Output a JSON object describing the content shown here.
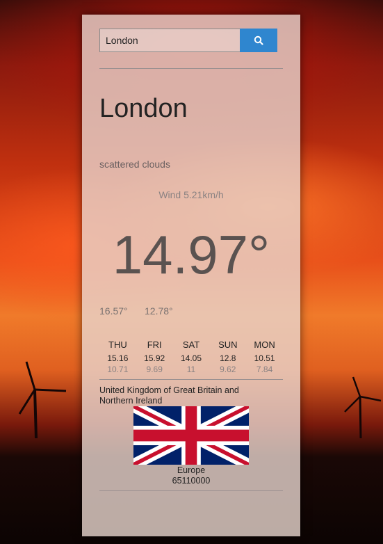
{
  "search": {
    "value": "London",
    "placeholder": ""
  },
  "weather": {
    "city": "London",
    "description": "scattered clouds",
    "wind": "Wind 5.21km/h",
    "temperature": "14.97°",
    "min": "16.57°",
    "max": "12.78°"
  },
  "forecast": [
    {
      "day": "THU",
      "high": "15.16",
      "low": "10.71"
    },
    {
      "day": "FRI",
      "high": "15.92",
      "low": "9.69"
    },
    {
      "day": "SAT",
      "high": "14.05",
      "low": "11"
    },
    {
      "day": "SUN",
      "high": "12.8",
      "low": "9.62"
    },
    {
      "day": "MON",
      "high": "10.51",
      "low": "7.84"
    }
  ],
  "country": {
    "name": "United Kingdom of Great Britain and Northern Ireland",
    "flag_icon": "union-jack-flag",
    "region": "Europe",
    "population": "65110000"
  },
  "colors": {
    "accent": "#2f86cf",
    "panel": "#e8d6ce"
  }
}
